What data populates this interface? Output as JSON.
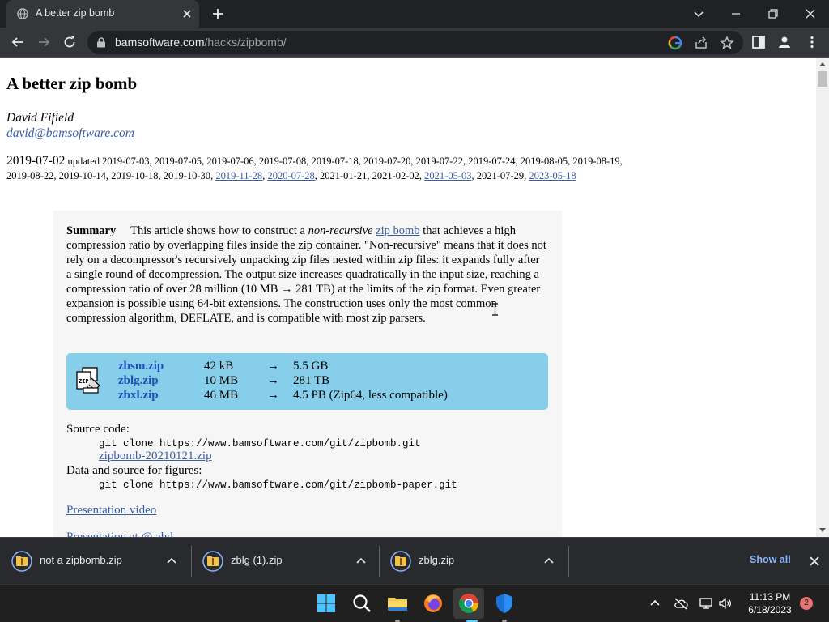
{
  "browser": {
    "tab_title": "A better zip bomb",
    "url_host": "bamsoftware.com",
    "url_path": "/hacks/zipbomb/"
  },
  "article": {
    "title": "A better zip bomb",
    "author": "David Fifield",
    "email": "david@bamsoftware.com",
    "published": "2019-07-02",
    "updated_label": "updated",
    "updates": [
      {
        "date": "2019-07-03",
        "link": false
      },
      {
        "date": "2019-07-05",
        "link": false
      },
      {
        "date": "2019-07-06",
        "link": false
      },
      {
        "date": "2019-07-08",
        "link": false
      },
      {
        "date": "2019-07-18",
        "link": false
      },
      {
        "date": "2019-07-20",
        "link": false
      },
      {
        "date": "2019-07-22",
        "link": false
      },
      {
        "date": "2019-07-24",
        "link": false
      },
      {
        "date": "2019-08-05",
        "link": false
      },
      {
        "date": "2019-08-19",
        "link": false
      },
      {
        "date": "2019-08-22",
        "link": false
      },
      {
        "date": "2019-10-14",
        "link": false
      },
      {
        "date": "2019-10-18",
        "link": false
      },
      {
        "date": "2019-10-30",
        "link": false
      },
      {
        "date": "2019-11-28",
        "link": true
      },
      {
        "date": "2020-07-28",
        "link": true
      },
      {
        "date": "2021-01-21",
        "link": false
      },
      {
        "date": "2021-02-02",
        "link": false
      },
      {
        "date": "2021-05-03",
        "link": true
      },
      {
        "date": "2021-07-29",
        "link": false
      },
      {
        "date": "2023-05-18",
        "link": true
      }
    ],
    "summary": {
      "label": "Summary",
      "text_1": "This article shows how to construct a ",
      "non_recursive": "non-recursive",
      "zip_bomb_link": "zip bomb",
      "text_2": " that achieves a high compression ratio by overlapping files inside the zip container. \"Non-recursive\" means that it does not rely on a decompressor's recursively unpacking zip files nested within zip files: it expands fully after a single round of decompression. The output size increases quadratically in the input size, reaching a compression ratio of over 28 million (10 MB → 281 TB) at the limits of the zip format. Even greater expansion is possible using 64-bit extensions. The construction uses only the most common compression algorithm, DEFLATE, and is compatible with most zip parsers."
    },
    "files": [
      {
        "name": "zbsm.zip",
        "size": "42 kB",
        "arrow": "→",
        "result": "5.5 GB"
      },
      {
        "name": "zblg.zip",
        "size": "10 MB",
        "arrow": "→",
        "result": "281 TB"
      },
      {
        "name": "zbxl.zip",
        "size": "46 MB",
        "arrow": "→",
        "result": "4.5 PB (Zip64, less compatible)"
      }
    ],
    "source_label": "Source code:",
    "source_git": "git clone https://www.bamsoftware.com/git/zipbomb.git",
    "source_zip": "zipbomb-20210121.zip",
    "data_label": "Data and source for figures:",
    "data_git": "git clone https://www.bamsoftware.com/git/zipbomb-paper.git",
    "video_link": "Presentation video",
    "cut_link": "Presentation at @ ahd"
  },
  "downloads": {
    "items": [
      {
        "name": "not a zipbomb.zip"
      },
      {
        "name": "zblg (1).zip"
      },
      {
        "name": "zblg.zip"
      }
    ],
    "show_all": "Show all"
  },
  "taskbar": {
    "time": "11:13 PM",
    "date": "6/18/2023",
    "notifications": "2"
  },
  "colors": {
    "link": "#3a5ea8",
    "file_panel": "#87ceeb",
    "file_link": "#1f4fb5",
    "show_all": "#8ab4f8"
  }
}
